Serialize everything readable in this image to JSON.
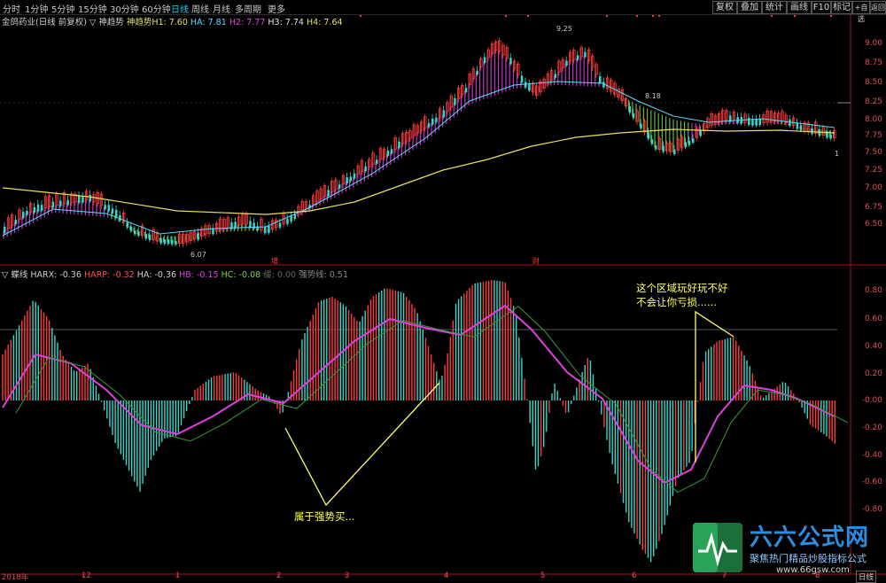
{
  "toolbar": {
    "periods": [
      "分时",
      "1分钟",
      "5分钟",
      "15分钟",
      "30分钟",
      "60分钟",
      "日线",
      "周线",
      "月线",
      "多周期",
      "更多"
    ],
    "active_period": "日线",
    "right_buttons": [
      "复权",
      "叠加",
      "统计",
      "画线",
      "F10",
      "标记",
      "+自选",
      "返回"
    ]
  },
  "main_legend": {
    "stock": "金鸽药业(日线 前复权)",
    "indicator": "▽ 神趋势",
    "h1_label": "神趋势H1: 7.60",
    "ha_label": "HA: 7.81",
    "h2_label": "H2: 7.77",
    "h3_label": "H3: 7.74",
    "h4_label": "H4: 7.64"
  },
  "sub_legend": {
    "indicator": "▽ 蝶线",
    "harx": "HARX: -0.36",
    "harp": "HARP: -0.32",
    "ha": "HA: -0.36",
    "hb": "HB: -0.15",
    "hc": "HC: -0.08",
    "extra1": "缓: 0.00",
    "extra2": "强势线: 0.51"
  },
  "price_axis": [
    "9.00",
    "8.75",
    "8.50",
    "8.25",
    "8.00",
    "7.75",
    "7.50",
    "7.25",
    "7.00",
    "6.75",
    "6.50"
  ],
  "osc_axis": [
    "0.80",
    "0.60",
    "0.40",
    "0.20",
    "-0.00",
    "-0.20",
    "-0.40",
    "-0.60",
    "-0.80"
  ],
  "price_annotations": {
    "high": "9.25",
    "mid": "8.18",
    "low": "6.07",
    "last": "1"
  },
  "event_markers": {
    "m1": "增",
    "m2": "财"
  },
  "annotations": {
    "strong_buy": "属于强势买...",
    "warning_line1": "这个区域玩好玩不好",
    "warning_line2": "不会让你亏损......"
  },
  "x_axis": {
    "year": "2018年",
    "months": [
      "12",
      "1",
      "2",
      "3",
      "4",
      "5",
      "6",
      "7",
      "8"
    ],
    "period_tag": "日线"
  },
  "watermark": {
    "brand": "六六公式网",
    "sub": "聚焦热门精品炒股指标公式",
    "url": "www.66gsw.com"
  },
  "colors": {
    "up": "#ff3c3c",
    "down": "#3ad6c9",
    "magenta": "#e040e0",
    "green": "#79d34a",
    "yellow": "#e8e060",
    "cyan": "#5ad8ff",
    "axis": "#b01010"
  }
}
